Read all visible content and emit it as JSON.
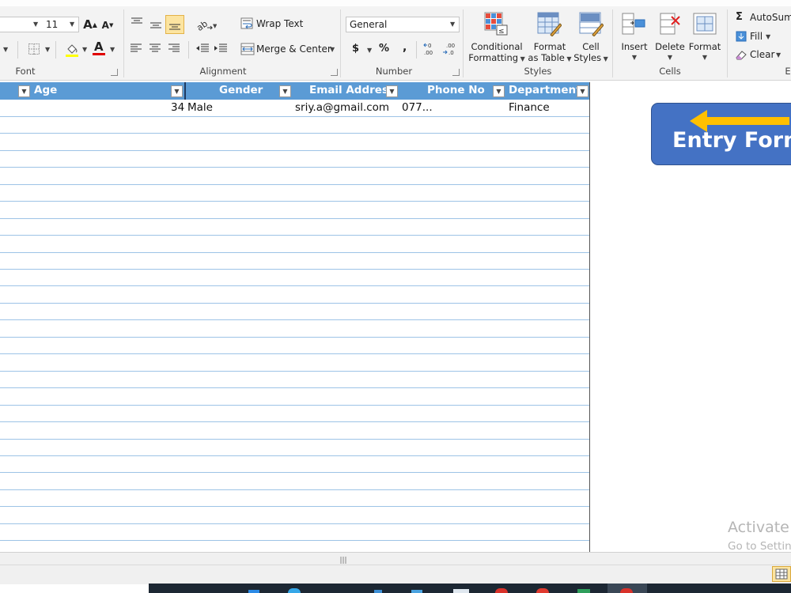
{
  "ribbon": {
    "font": {
      "size": "11",
      "group_label": "Font"
    },
    "alignment": {
      "wrap_text": "Wrap Text",
      "merge_center": "Merge & Center",
      "group_label": "Alignment"
    },
    "number": {
      "format": "General",
      "currency": "$",
      "percent": "%",
      "comma": ",",
      "group_label": "Number"
    },
    "styles": {
      "conditional_1": "Conditional",
      "conditional_2": "Formatting",
      "format_table_1": "Format",
      "format_table_2": "as Table",
      "cell_styles_1": "Cell",
      "cell_styles_2": "Styles",
      "group_label": "Styles"
    },
    "cells": {
      "insert": "Insert",
      "delete": "Delete",
      "format": "Format",
      "group_label": "Cells"
    },
    "editing": {
      "autosum": "AutoSum",
      "fill": "Fill",
      "clear": "Clear",
      "group_label_partial": "E"
    }
  },
  "table": {
    "headers": [
      "Age",
      "Gender",
      "Email Address",
      "Phone No",
      "Department"
    ],
    "rows": [
      {
        "age": "34",
        "gender": "Male",
        "email": "sriy.a@gmail.com",
        "phone": "077...",
        "department": "Finance"
      }
    ]
  },
  "entry_form_button": {
    "label": "Entry Form"
  },
  "watermark": {
    "line1": "Activate",
    "line2": "Go to Settin"
  },
  "colors": {
    "header_blue": "#5b9bd5",
    "row_line": "#9dc3e6",
    "button_blue": "#4472c4",
    "arrow_orange": "#ffc000"
  }
}
